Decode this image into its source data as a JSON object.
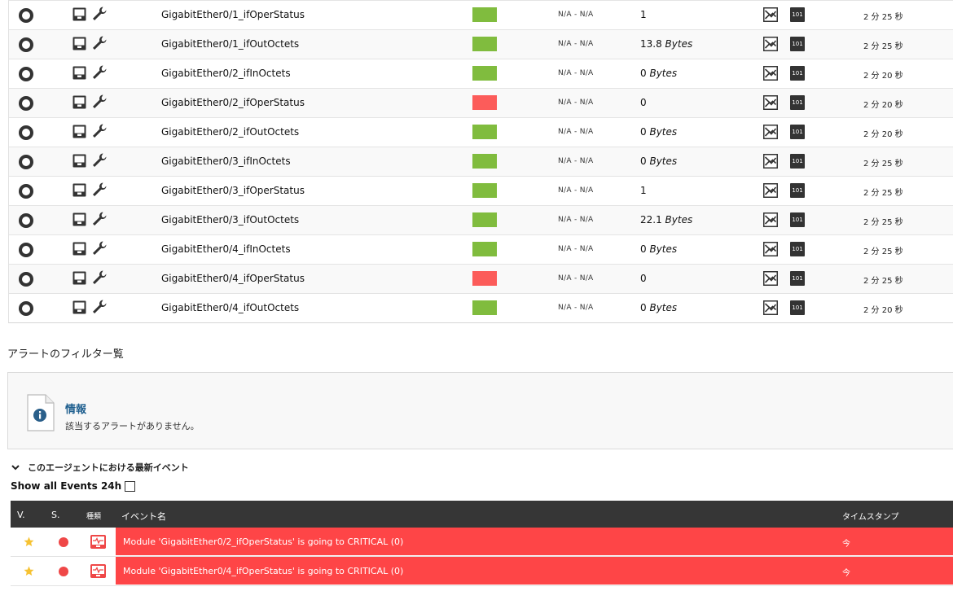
{
  "modules": [
    {
      "name": "GigabitEther0/1_ifOperStatus",
      "status": "green",
      "thresholds": "N/A - N/A",
      "value": "1",
      "unit": "",
      "last_contact": "2 分 25 秒",
      "raw_label": "101"
    },
    {
      "name": "GigabitEther0/1_ifOutOctets",
      "status": "green",
      "thresholds": "N/A - N/A",
      "value": "13.8",
      "unit": "Bytes",
      "last_contact": "2 分 25 秒",
      "raw_label": "101"
    },
    {
      "name": "GigabitEther0/2_ifInOctets",
      "status": "green",
      "thresholds": "N/A - N/A",
      "value": "0",
      "unit": "Bytes",
      "last_contact": "2 分 20 秒",
      "raw_label": "101"
    },
    {
      "name": "GigabitEther0/2_ifOperStatus",
      "status": "red",
      "thresholds": "N/A - N/A",
      "value": "0",
      "unit": "",
      "last_contact": "2 分 20 秒",
      "raw_label": "101"
    },
    {
      "name": "GigabitEther0/2_ifOutOctets",
      "status": "green",
      "thresholds": "N/A - N/A",
      "value": "0",
      "unit": "Bytes",
      "last_contact": "2 分 20 秒",
      "raw_label": "101"
    },
    {
      "name": "GigabitEther0/3_ifInOctets",
      "status": "green",
      "thresholds": "N/A - N/A",
      "value": "0",
      "unit": "Bytes",
      "last_contact": "2 分 25 秒",
      "raw_label": "101"
    },
    {
      "name": "GigabitEther0/3_ifOperStatus",
      "status": "green",
      "thresholds": "N/A - N/A",
      "value": "1",
      "unit": "",
      "last_contact": "2 分 25 秒",
      "raw_label": "101"
    },
    {
      "name": "GigabitEther0/3_ifOutOctets",
      "status": "green",
      "thresholds": "N/A - N/A",
      "value": "22.1",
      "unit": "Bytes",
      "last_contact": "2 分 25 秒",
      "raw_label": "101"
    },
    {
      "name": "GigabitEther0/4_ifInOctets",
      "status": "green",
      "thresholds": "N/A - N/A",
      "value": "0",
      "unit": "Bytes",
      "last_contact": "2 分 25 秒",
      "raw_label": "101"
    },
    {
      "name": "GigabitEther0/4_ifOperStatus",
      "status": "red",
      "thresholds": "N/A - N/A",
      "value": "0",
      "unit": "",
      "last_contact": "2 分 25 秒",
      "raw_label": "101"
    },
    {
      "name": "GigabitEther0/4_ifOutOctets",
      "status": "green",
      "thresholds": "N/A - N/A",
      "value": "0",
      "unit": "Bytes",
      "last_contact": "2 分 20 秒",
      "raw_label": "101"
    }
  ],
  "status_colors": {
    "green": "#80bc3e",
    "red": "#fc5c5a"
  },
  "alert_filter": {
    "title": "アラートのフィルター覧",
    "info_title": "情報",
    "info_message": "該当するアラートがありません。"
  },
  "events": {
    "section_title": "このエージェントにおける最新イベント",
    "show_all_label": "Show all Events 24h",
    "show_all_checked": false,
    "headers": {
      "v": "V.",
      "s": "S.",
      "type": "種類",
      "name": "イベント名",
      "timestamp": "タイムスタンプ"
    },
    "rows": [
      {
        "name": "Module 'GigabitEther0/2_ifOperStatus' is going to CRITICAL (0)",
        "timestamp": "今"
      },
      {
        "name": "Module 'GigabitEther0/4_ifOperStatus' is going to CRITICAL (0)",
        "timestamp": "今"
      }
    ],
    "critical_color": "#fe4547"
  }
}
